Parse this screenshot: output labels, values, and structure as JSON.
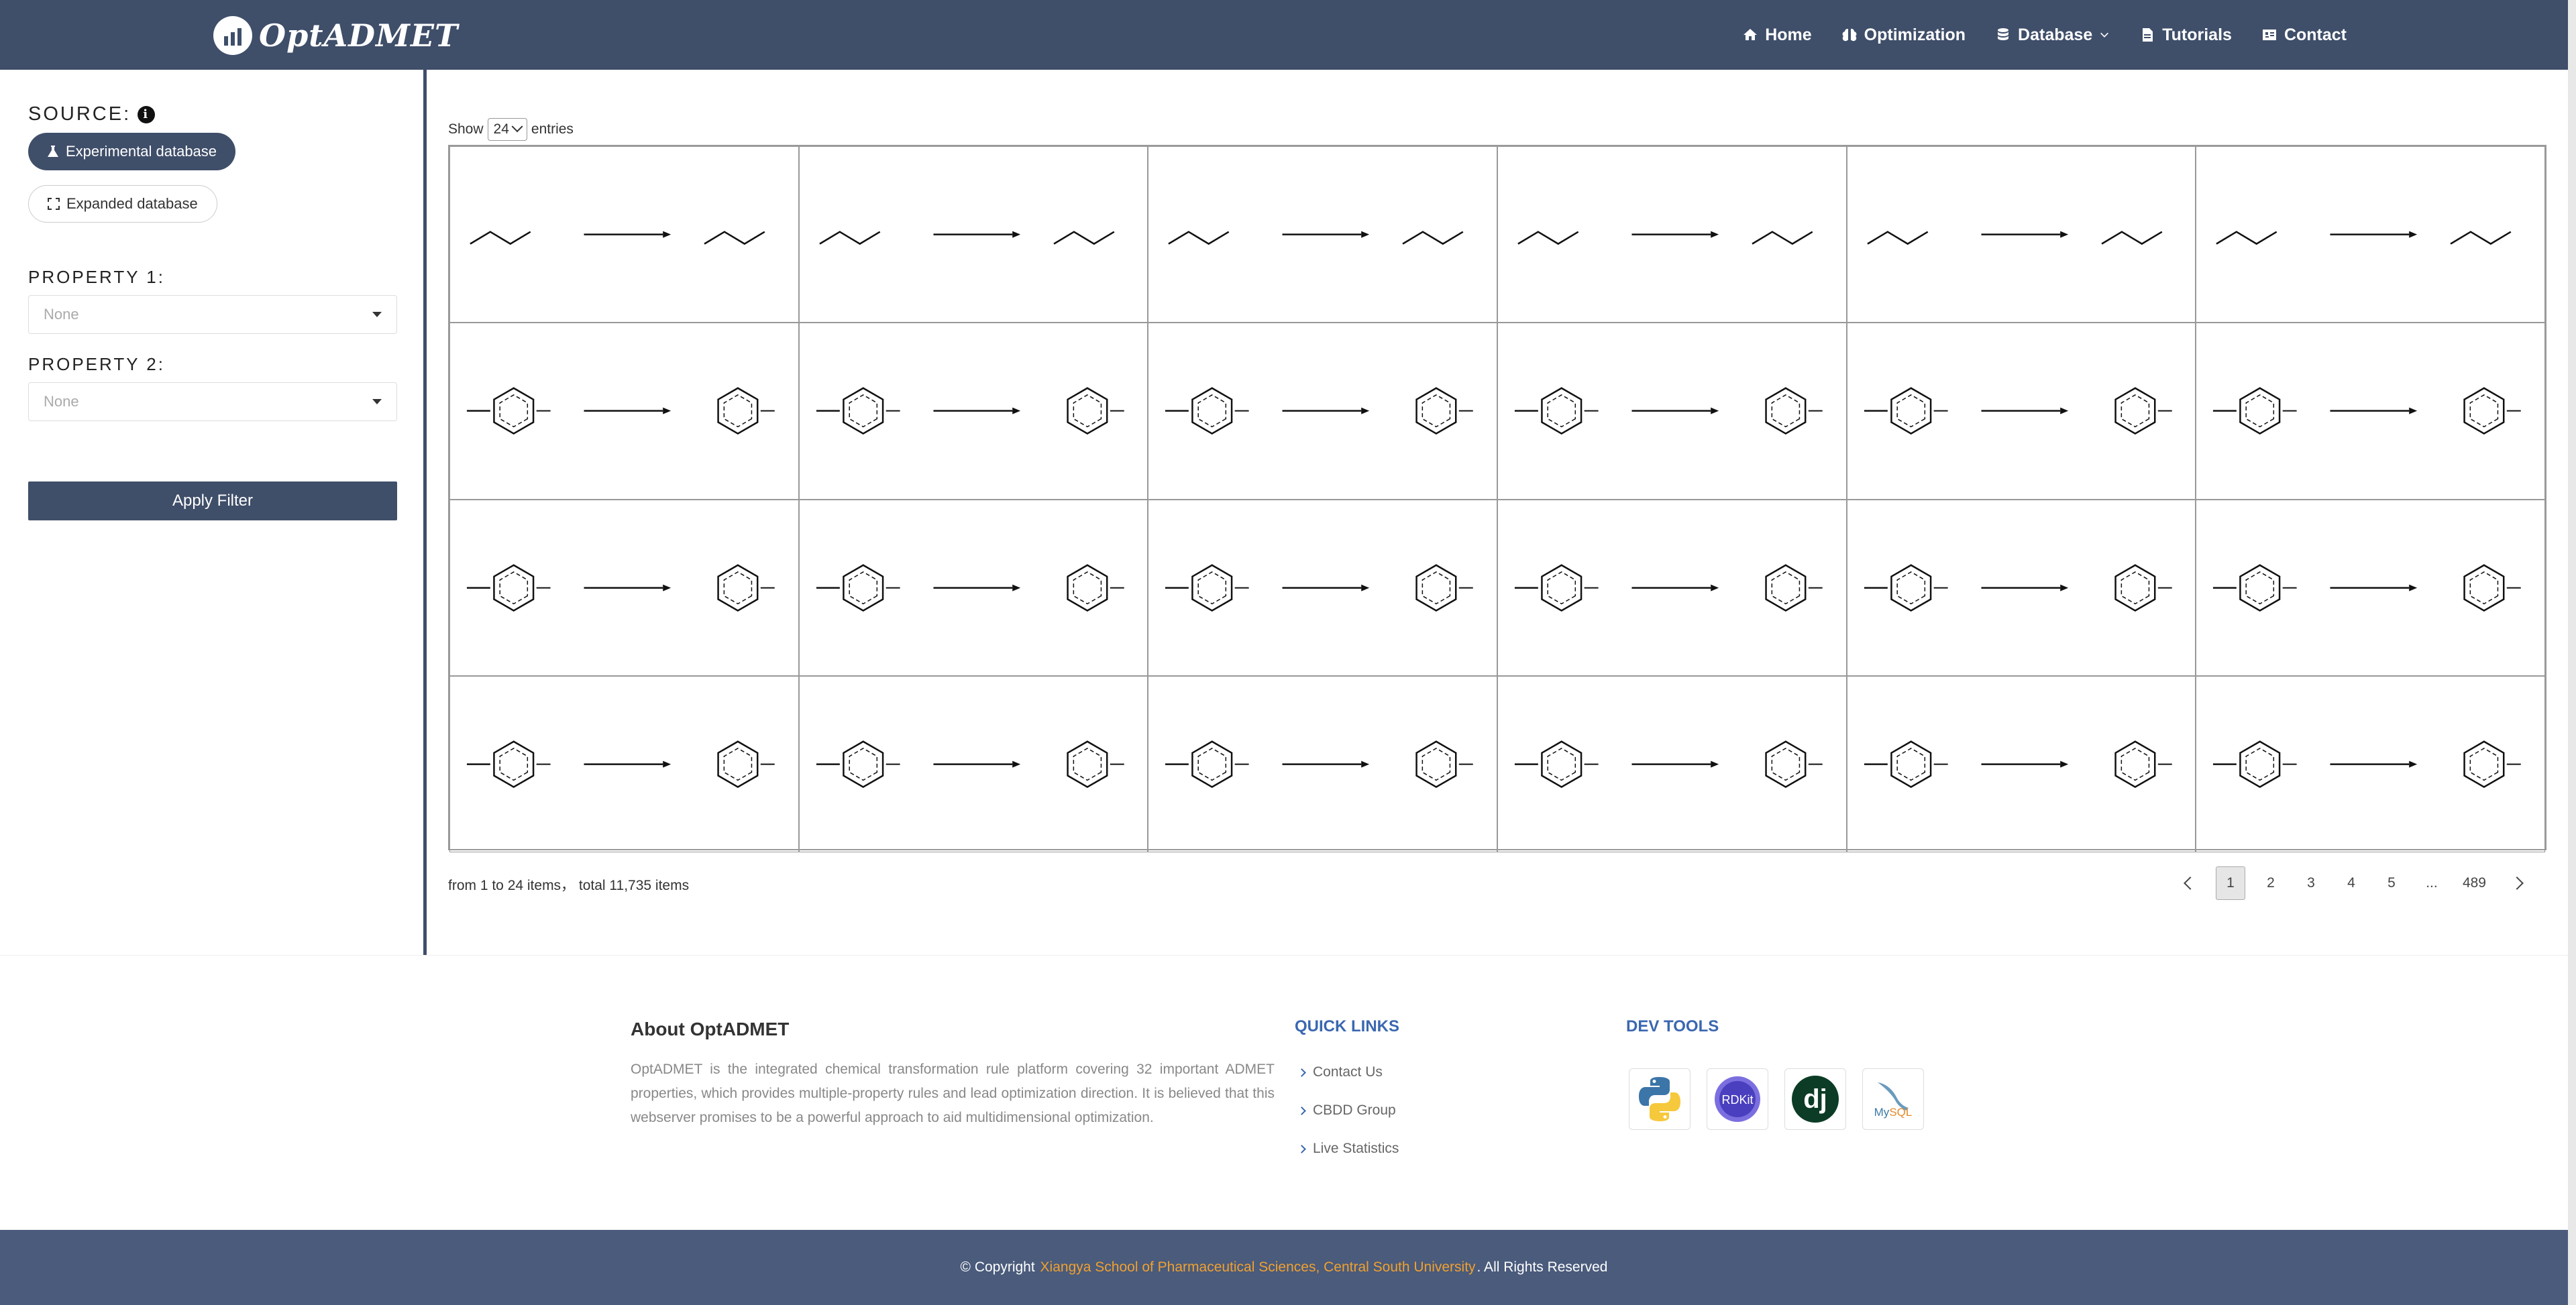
{
  "header": {
    "app_title": "OptADMET",
    "nav": [
      {
        "label": "Home",
        "icon": "home-icon"
      },
      {
        "label": "Optimization",
        "icon": "brain-icon"
      },
      {
        "label": "Database",
        "icon": "database-icon"
      },
      {
        "label": "Tutorials",
        "icon": "document-icon"
      },
      {
        "label": "Contact",
        "icon": "contact-card-icon"
      }
    ]
  },
  "sidebar": {
    "source_label": "SOURCE:",
    "experimental_label": "Experimental database",
    "expanded_label": "Expanded database",
    "property1_label": "PROPERTY 1:",
    "property1_value": "None",
    "property2_label": "PROPERTY 2:",
    "property2_value": "None",
    "apply_label": "Apply Filter"
  },
  "main": {
    "show_prefix": "Show",
    "show_value": "24",
    "show_suffix": "entries",
    "rules_count": 24,
    "range_text": "from 1 to 24 items，  total 11,735 items",
    "pages": [
      "1",
      "2",
      "3",
      "4",
      "5",
      "...",
      "489"
    ],
    "current_page": "1"
  },
  "footer": {
    "about_title": "About OptADMET",
    "about_text": "OptADMET is the integrated chemical transformation rule platform covering 32 important ADMET properties, which provides multiple-property rules and lead optimization direction. It is believed that this webserver promises to be a powerful approach to aid multidimensional optimization.",
    "quick_links_title": "QUICK LINKS",
    "quick_links": [
      "Contact Us",
      "CBDD Group",
      "Live Statistics"
    ],
    "dev_tools_title": "DEV TOOLS",
    "dev_tools": [
      "python-logo",
      "rdkit-logo",
      "django-logo",
      "mysql-logo"
    ],
    "copyright_prefix": "© Copyright ",
    "copyright_org": "Xiangya School of Pharmaceutical Sciences, Central South University",
    "copyright_suffix": ". All Rights Reserved"
  },
  "colors": {
    "primary": "#3f4e69",
    "link_blue": "#3a67b0",
    "accent_orange": "#f0a030"
  }
}
